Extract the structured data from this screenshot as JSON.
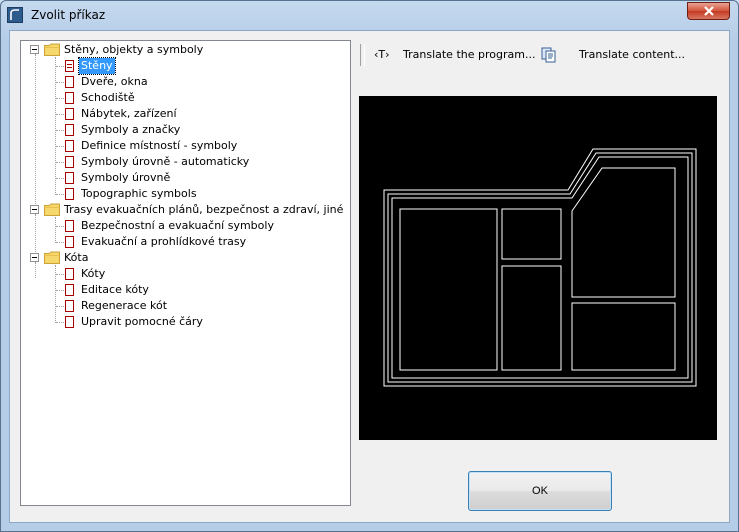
{
  "window": {
    "title": "Zvolit příkaz"
  },
  "tree": {
    "groups": [
      {
        "label": "Stěny, objekty a symboly",
        "items": [
          "Stěny",
          "Dveře, okna",
          "Schodiště",
          "Nábytek, zařízení",
          "Symboly a značky",
          "Definice místností - symboly",
          "Symboly úrovně - automaticky",
          "Symboly úrovně",
          "Topographic symbols"
        ]
      },
      {
        "label": "Trasy evakuačních plánů, bezpečnost a zdraví, jiné",
        "items": [
          "Bezpečnostní a evakuační symboly",
          "Evakuační a prohlídkové trasy"
        ]
      },
      {
        "label": "Kóta",
        "items": [
          "Kóty",
          "Editace kóty",
          "Regenerace kót",
          "Upravit pomocné čáry"
        ]
      }
    ],
    "selected": "Stěny"
  },
  "toolbar": {
    "translate_program_label": "Translate the program...",
    "translate_program_icon": "‹T›",
    "translate_content_label": "Translate content..."
  },
  "buttons": {
    "ok_label": "OK"
  },
  "preview": {
    "background": "#000000",
    "stroke": "#ffffff"
  }
}
